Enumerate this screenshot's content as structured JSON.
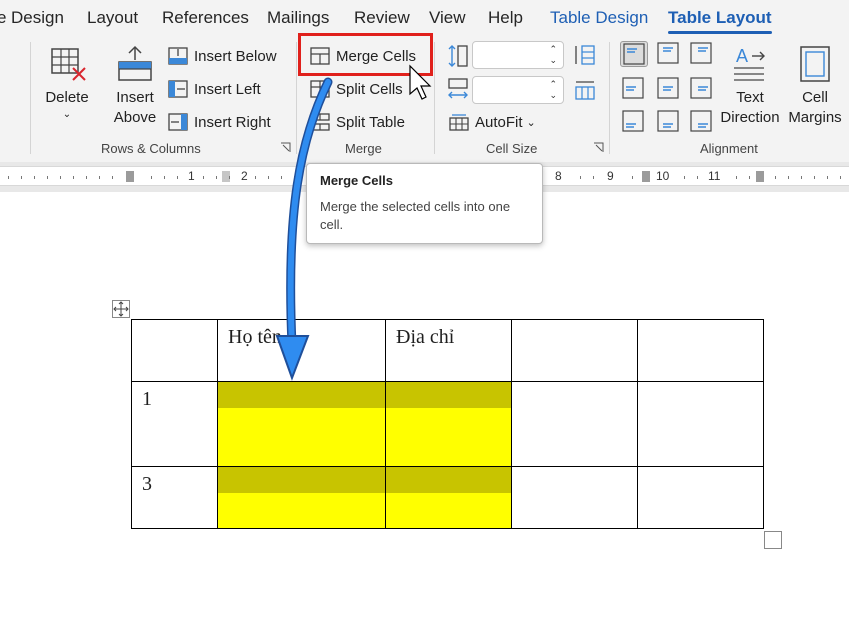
{
  "menu": {
    "tabs": [
      {
        "label": "Design"
      },
      {
        "label": "Layout"
      },
      {
        "label": "References"
      },
      {
        "label": "Mailings"
      },
      {
        "label": "Review"
      },
      {
        "label": "View"
      },
      {
        "label": "Help"
      },
      {
        "label": "Table Design"
      },
      {
        "label": "Table Layout"
      }
    ],
    "partial_left": "e"
  },
  "ribbon": {
    "rows_columns": {
      "delete": "Delete",
      "insert_above": [
        "Insert",
        "Above"
      ],
      "insert_below": "Insert Below",
      "insert_left": "Insert Left",
      "insert_right": "Insert Right",
      "label": "Rows & Columns"
    },
    "merge": {
      "merge_cells": "Merge Cells",
      "split_cells": "Split Cells",
      "split_table": "Split Table",
      "label": "Merge"
    },
    "cell_size": {
      "autofit": "AutoFit",
      "label": "Cell Size"
    },
    "alignment": {
      "text_direction": [
        "Text",
        "Direction"
      ],
      "cell_margins": [
        "Cell",
        "Margins"
      ],
      "label": "Alignment"
    }
  },
  "ruler": {
    "numbers": [
      "1",
      "2",
      "8",
      "9",
      "10",
      "11"
    ]
  },
  "tooltip": {
    "title": "Merge Cells",
    "description": "Merge the selected cells into one cell."
  },
  "table": {
    "header": [
      "",
      "Họ tên",
      "Địa chỉ",
      "",
      ""
    ],
    "row1": [
      "1",
      "",
      "",
      "",
      ""
    ],
    "row2": [
      "3",
      "",
      "",
      "",
      ""
    ]
  },
  "colors": {
    "accent": "#1e5fb4",
    "highlight_border": "#e0201b",
    "selection_fill": "#ffff00",
    "selection_band": "#c8c400",
    "arrow": "#1f77e0"
  }
}
